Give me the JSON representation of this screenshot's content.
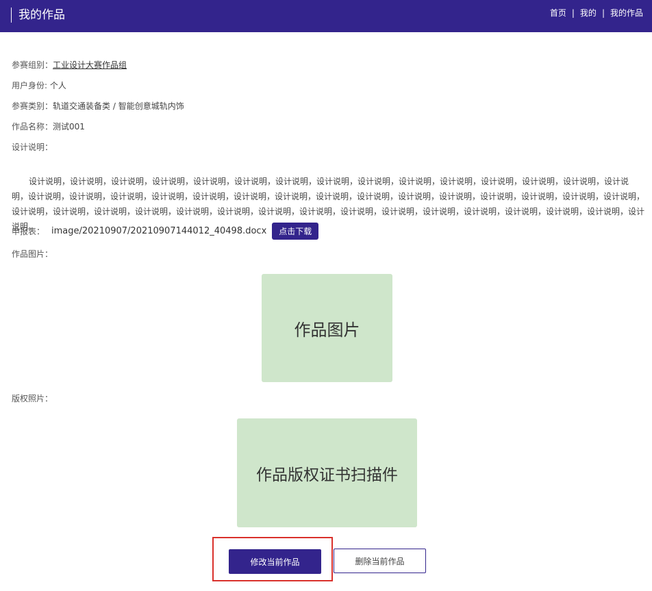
{
  "header": {
    "title": "我的作品",
    "nav": [
      {
        "label": "首页"
      },
      {
        "label": "我的"
      },
      {
        "label": "我的作品"
      }
    ],
    "separator": "|",
    "bg_color": "#33248c"
  },
  "details": {
    "group_label": "参赛组别：",
    "group_value": "工业设计大赛作品组",
    "identity_label": "用户身份: ",
    "identity_value": "个人",
    "category_label": "参赛类别：",
    "category_value": "轨道交通装备类 / 智能创意城轨内饰",
    "work_name_label": "作品名称：",
    "work_name_value": "测试001",
    "design_desc_label": "设计说明：",
    "design_desc_text": "设计说明，设计说明，设计说明，设计说明，设计说明，设计说明，设计说明，设计说明，设计说明，设计说明，设计说明，设计说明，设计说明，设计说明，设计说明，设计说明，设计说明，设计说明，设计说明，设计说明，设计说明，设计说明，设计说明，设计说明，设计说明，设计说明，设计说明，设计说明，设计说明，设计说明，设计说明，设计说明，设计说明，设计说明，设计说明，设计说明，设计说明，设计说明，设计说明，设计说明，设计说明，设计说明，设计说明，设计说明，设计说明，设计说明。",
    "form_label": "申报表：",
    "form_file": "image/20210907/20210907144012_40498.docx",
    "download_button": "点击下载",
    "work_image_label": "作品图片：",
    "work_image_placeholder": "作品图片",
    "copyright_label": "版权照片：",
    "copyright_placeholder": "作品版权证书扫描件"
  },
  "actions": {
    "edit_button": "修改当前作品",
    "delete_button": "删除当前作品"
  },
  "colors": {
    "primary": "#33248c",
    "image_placeholder_bg": "#cfe6cb",
    "highlight_border": "#d9302b"
  }
}
